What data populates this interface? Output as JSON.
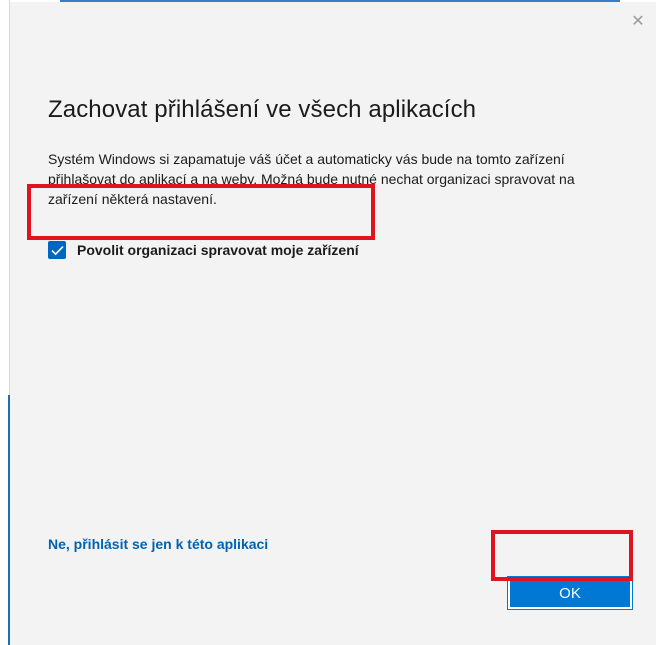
{
  "dialog": {
    "close_glyph": "✕",
    "heading": "Zachovat přihlášení ve všech aplikacích",
    "description": "Systém Windows si zapamatuje váš účet a automaticky vás bude na tomto zařízení přihlašovat do aplikací a na weby. Možná bude nutné nechat organizaci spravovat na zařízení některá nastavení.",
    "checkbox": {
      "label": "Povolit organizaci spravovat moje zařízení",
      "checked": true
    },
    "secondary_link": "Ne, přihlásit se jen k této aplikaci",
    "ok_label": "OK"
  },
  "colors": {
    "accent": "#0078d4",
    "checkbox": "#0067c0",
    "link": "#0063b1",
    "highlight": "#e0141e",
    "background": "#f3f3f3"
  }
}
